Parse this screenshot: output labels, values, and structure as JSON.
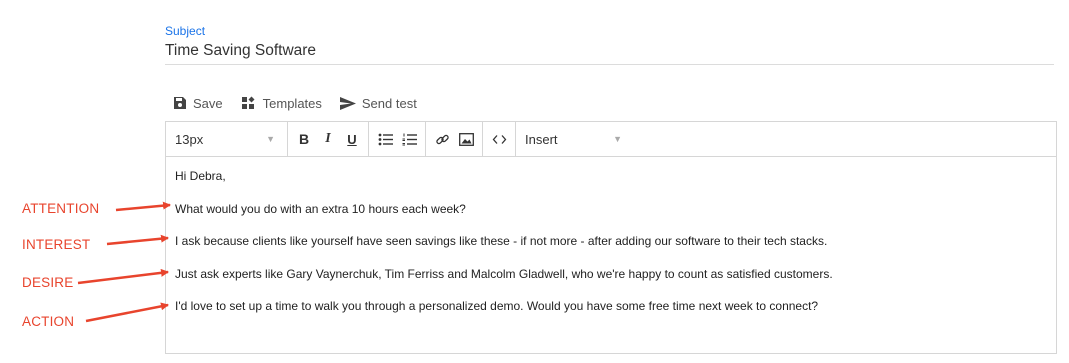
{
  "subject": {
    "label": "Subject",
    "value": "Time Saving Software"
  },
  "toolbar": {
    "save_label": "Save",
    "templates_label": "Templates",
    "send_test_label": "Send test"
  },
  "editor": {
    "font_size": "13px",
    "insert_label": "Insert",
    "body_lines": [
      "Hi Debra,",
      "What would you do with an extra 10 hours each week?",
      "I ask because clients like yourself have seen savings like these - if not more - after adding our software to their tech stacks.",
      "Just ask experts like Gary Vaynerchuk, Tim Ferriss and Malcolm Gladwell, who we're happy to count as satisfied customers.",
      "I'd love to set up a time to walk you through a personalized demo. Would you have some free time next week to connect?"
    ]
  },
  "annotations": [
    "ATTENTION",
    "INTEREST",
    "DESIRE",
    "ACTION"
  ],
  "colors": {
    "accent": "#1a73e8",
    "annotation": "#e8442d",
    "border": "#d6d6d6"
  }
}
